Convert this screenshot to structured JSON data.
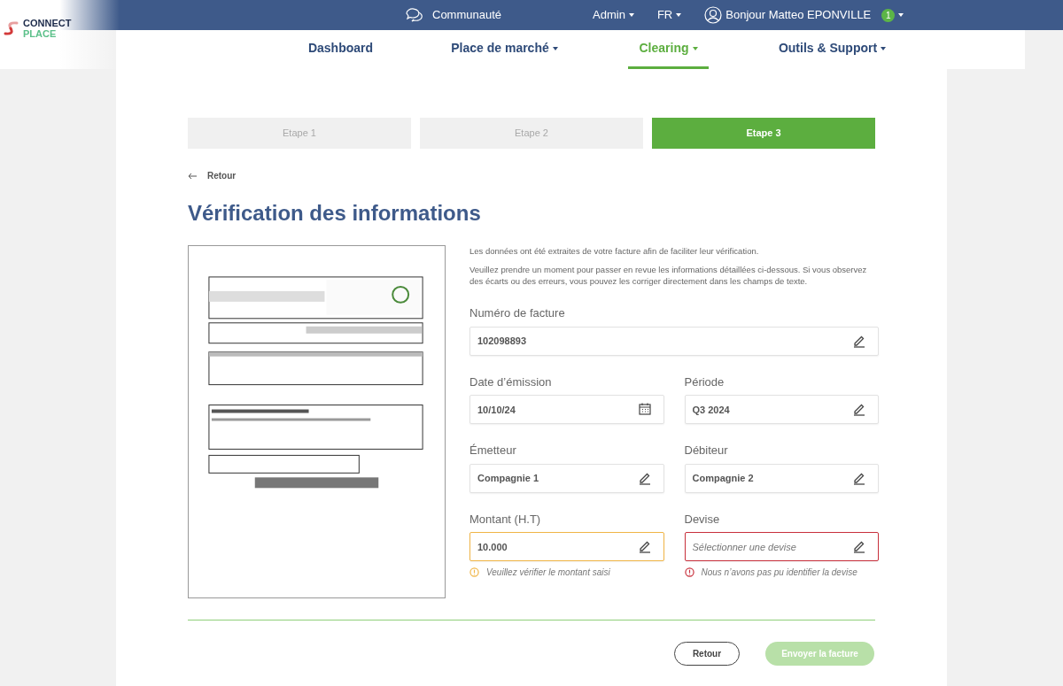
{
  "logo": {
    "line1": "CONNECT",
    "line2": "PLACE"
  },
  "topbar": {
    "community": "Communauté",
    "menus": [
      "Admin",
      "FR"
    ],
    "user": "Bonjour Matteo EPONVILLE",
    "notifications": "1"
  },
  "nav": [
    {
      "label": "Dashboard",
      "dropdown": false,
      "selected": false
    },
    {
      "label": "Place de marché",
      "dropdown": true,
      "selected": false
    },
    {
      "label": "Clearing",
      "dropdown": true,
      "selected": true
    },
    {
      "label": "Outils & Support",
      "dropdown": true,
      "selected": false
    }
  ],
  "steps": [
    {
      "label": "Etape 1",
      "selected": false
    },
    {
      "label": "Etape 2",
      "selected": false
    },
    {
      "label": "Etape 3",
      "selected": true
    }
  ],
  "back": "Retour",
  "title": "Vérification des informations",
  "invoice_preview": {
    "kind": "picture"
  },
  "intro": [
    "Les données ont été extraites de votre facture afin de faciliter leur vérification.",
    "Veuillez prendre un moment pour passer en revue les informations détaillées ci-dessous. Si vous observez des écarts ou des erreurs, vous pouvez les corriger directement dans les champs de texte."
  ],
  "field_rows": [
    [
      {
        "label": "Numéro de facture",
        "value": "102098893",
        "kind": "text",
        "warning": false,
        "error": false
      }
    ],
    [
      {
        "label": "Date d’émission",
        "value": "10/10/24",
        "kind": "date",
        "warning": false,
        "error": false
      },
      {
        "label": "Période",
        "value": "Q3 2024",
        "kind": "text",
        "warning": false,
        "error": false
      }
    ],
    [
      {
        "label": "Émetteur",
        "value": "Compagnie 1",
        "kind": "text",
        "warning": false,
        "error": false
      },
      {
        "label": "Débiteur",
        "value": "Compagnie 2",
        "kind": "text",
        "warning": false,
        "error": false
      }
    ],
    [
      {
        "label": "Montant (H.T)",
        "value": "10.000",
        "kind": "text",
        "warning": true,
        "error": false,
        "message": "Veuillez vérifier le montant saisi"
      },
      {
        "label": "Devise",
        "placeholder": "Sélectionner une devise",
        "kind": "text",
        "warning": false,
        "error": true,
        "message": "Nous n’avons pas pu identifier la devise"
      }
    ]
  ],
  "footer": {
    "back": "Retour",
    "submit": {
      "label": "Envoyer la facture",
      "disabled": true
    }
  }
}
